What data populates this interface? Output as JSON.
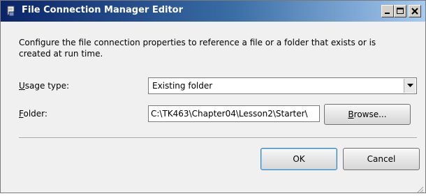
{
  "window": {
    "title": "File Connection Manager Editor",
    "titlebar_colors": [
      "#0a246a",
      "#a6caf0"
    ]
  },
  "titlebar_buttons": {
    "minimize": "minimize-icon",
    "maximize": "maximize-icon",
    "close": "close-icon"
  },
  "description": "Configure the file connection properties to reference a file or a folder that exists or is created at run time.",
  "usage_type": {
    "label_accesskey": "U",
    "label_rest": "sage type:",
    "value": "Existing folder"
  },
  "folder": {
    "label_accesskey": "F",
    "label_rest": "older:",
    "value": "C:\\TK463\\Chapter04\\Lesson2\\Starter\\"
  },
  "buttons": {
    "browse_accesskey": "B",
    "browse_rest": "rowse...",
    "ok": "OK",
    "cancel": "Cancel"
  }
}
